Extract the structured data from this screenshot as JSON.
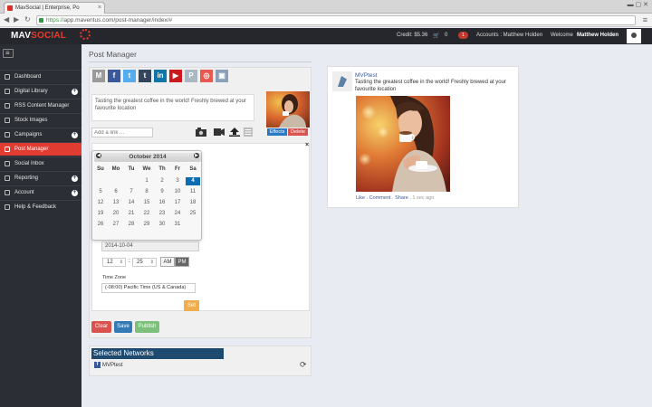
{
  "browser": {
    "tab_title": "MavSocial | Enterprise, Po",
    "url_scheme": "https://",
    "url_rest": "app.maventus.com/post-manager/index/#"
  },
  "header": {
    "logo_mav": "MAV",
    "logo_social": "SOCIAL",
    "credit": "Credit: $5.36",
    "cart_count": "0",
    "notif_count": "1",
    "accounts": "Accounts : Matthew Holden",
    "welcome_label": "Welcome",
    "user_name": "Matthew Holden"
  },
  "sidebar": {
    "items": [
      {
        "label": "Dashboard",
        "has_plus": false
      },
      {
        "label": "Digital Library",
        "has_plus": true
      },
      {
        "label": "RSS Content Manager",
        "has_plus": false
      },
      {
        "label": "Stock Images",
        "has_plus": false
      },
      {
        "label": "Campaigns",
        "has_plus": true
      },
      {
        "label": "Post Manager",
        "has_plus": false,
        "active": true
      },
      {
        "label": "Social Inbox",
        "has_plus": false
      },
      {
        "label": "Reporting",
        "has_plus": true
      },
      {
        "label": "Account",
        "has_plus": true
      },
      {
        "label": "Help & Feedback",
        "has_plus": false
      }
    ]
  },
  "main": {
    "page_title": "Post Manager",
    "networks_icons": [
      {
        "glyph": "M",
        "color": "#9a9a9a"
      },
      {
        "glyph": "f",
        "color": "#3b5998"
      },
      {
        "glyph": "t",
        "color": "#55acee"
      },
      {
        "glyph": "t",
        "color": "#35465c"
      },
      {
        "glyph": "in",
        "color": "#0e76a8"
      },
      {
        "glyph": "▶",
        "color": "#cc181e"
      },
      {
        "glyph": "P",
        "color": "#aab8c2"
      },
      {
        "glyph": "◎",
        "color": "#e8584f"
      },
      {
        "glyph": "▣",
        "color": "#8aa0b8"
      }
    ],
    "post_text": "Tasting the greatest coffee in the world! Freshly brewed at your favourite location",
    "effects_label": "Effects",
    "delete_label": "Delete",
    "link_placeholder": "Add a link ...",
    "close_symbol": "×",
    "calendar": {
      "title": "October 2014",
      "dow": [
        "Su",
        "Mo",
        "Tu",
        "We",
        "Th",
        "Fr",
        "Sa"
      ],
      "rows": [
        [
          "",
          "",
          "",
          "1",
          "2",
          "3",
          "4"
        ],
        [
          "5",
          "6",
          "7",
          "8",
          "9",
          "10",
          "11"
        ],
        [
          "12",
          "13",
          "14",
          "15",
          "16",
          "17",
          "18"
        ],
        [
          "19",
          "20",
          "21",
          "22",
          "23",
          "24",
          "25"
        ],
        [
          "26",
          "27",
          "28",
          "29",
          "30",
          "31",
          ""
        ]
      ],
      "selected": "4"
    },
    "date_value": "2014-10-04",
    "hour": "12",
    "minute": "25",
    "am_label": "AM",
    "pm_label": "PM",
    "timezone_label": "Time Zone",
    "timezone_value": "(-08:00) Pacific Time (US & Canada)",
    "set_label": "Set",
    "clear_label": "Clear",
    "save_label": "Save",
    "publish_label": "Publish",
    "selected_networks_title": "Selected Networks",
    "selected_network": "MVPtest"
  },
  "preview": {
    "name": "MVPtest",
    "text": "Tasting the greatest coffee in the world! Freshly brewed at your favourite location",
    "like": "Like",
    "comment": "Comment",
    "share": "Share",
    "time": "1 sec ago"
  }
}
